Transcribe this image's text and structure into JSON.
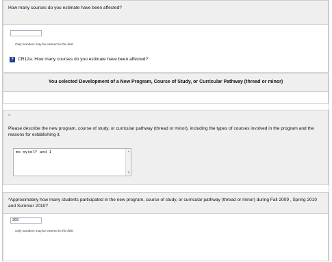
{
  "q_courses": {
    "question": "How many courses do you estimate have been affected?",
    "input_value": "",
    "hint": "Only numbers may be entered in this field",
    "help_icon": "?",
    "help_text": "CR12a.  How many courses do you estimate have been affected?"
  },
  "banner": {
    "text": "You selected Development of a New Program, Course of Study, or Curricular Pathway (thread or minor)"
  },
  "q_describe": {
    "required_mark": "*",
    "question": "Please describe the new program, course of study, or curricular pathway (thread or minor), including the types of courses involved in the program and the reasons for establishing it.",
    "answer": "me myself and I"
  },
  "q_students": {
    "question": "*Approximately how many students participated in the new program, course of study, or curricular pathway (thread or minor) during Fall 2009 , Spring 2010 and  Summer 2010?",
    "input_value": "369",
    "hint": "Only numbers may be entered in this field"
  },
  "colors": {
    "section_gray": "#efefef",
    "border": "#cfcfcf",
    "help_icon_bg": "#1d3f8f",
    "required_red": "#d21e1e"
  }
}
